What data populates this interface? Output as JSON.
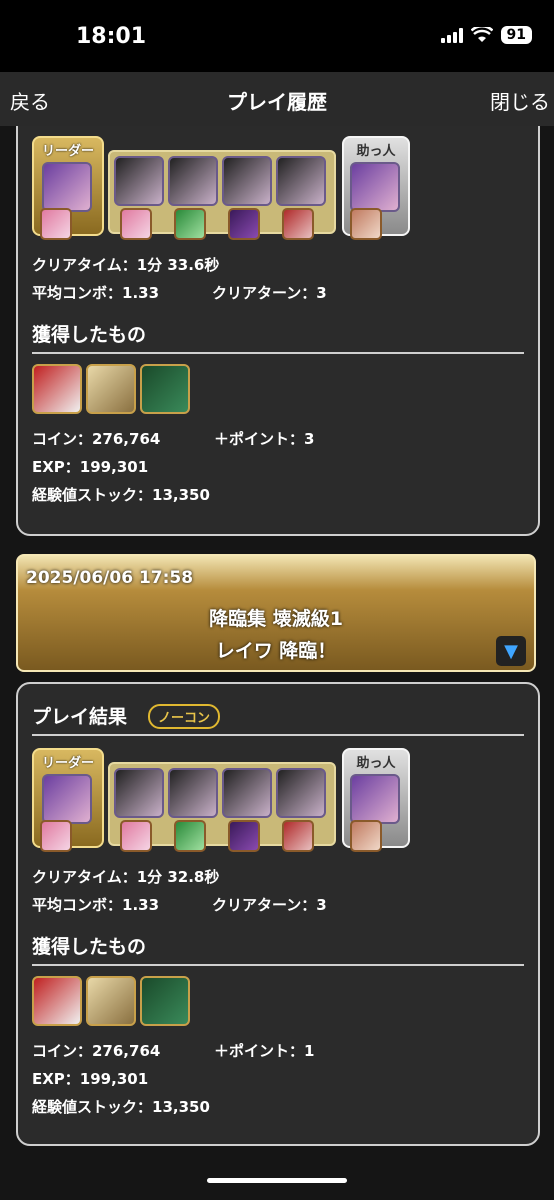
{
  "status_bar": {
    "time": "18:01",
    "battery": "91"
  },
  "nav": {
    "back": "戻る",
    "title": "プレイ履歴",
    "close": "閉じる"
  },
  "labels": {
    "leader": "リーダー",
    "helper": "助っ人",
    "acquired": "獲得したもの",
    "play_result": "プレイ結果",
    "nocon": "ノーコン"
  },
  "run1": {
    "clear_time": "クリアタイム：1分 33.6秒",
    "avg_combo": "平均コンボ：1.33",
    "clear_turn": "クリアターン：3",
    "coin": "コイン：276,764",
    "points": "＋ポイント：3",
    "exp": "EXP：199,301",
    "exp_stock": "経験値ストック：13,350"
  },
  "history2": {
    "date": "2025/06/06 17:58",
    "dungeon": "降臨集 壊滅級1",
    "floor": "レイワ 降臨！",
    "toggle_icon": "triangle-down-icon"
  },
  "run2": {
    "clear_time": "クリアタイム：1分 32.8秒",
    "avg_combo": "平均コンボ：1.33",
    "clear_turn": "クリアターン：3",
    "coin": "コイン：276,764",
    "points": "＋ポイント：1",
    "exp": "EXP：199,301",
    "exp_stock": "経験値ストック：13,350"
  },
  "colors": {
    "accent_gold": "#c9a24a",
    "toggle_blue": "#3fa5ff",
    "card_bg": "#2b2b2b"
  }
}
